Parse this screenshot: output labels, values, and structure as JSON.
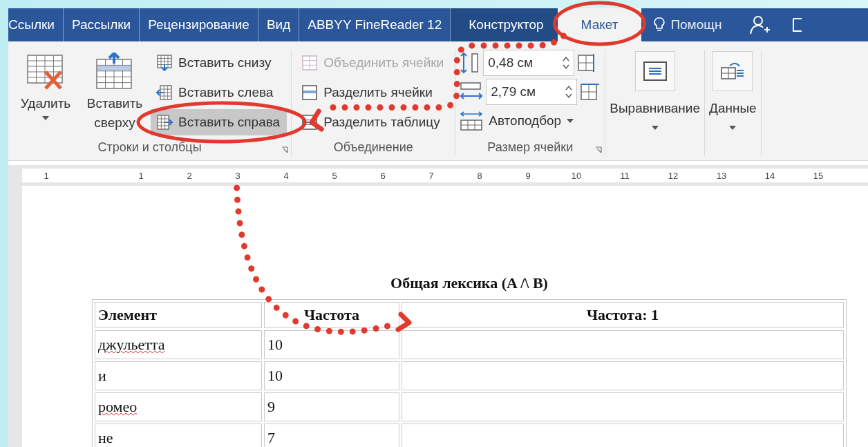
{
  "tabs": [
    {
      "label": "Ссылки",
      "selected": false
    },
    {
      "label": "Рассылки",
      "selected": false
    },
    {
      "label": "Рецензирование",
      "selected": false
    },
    {
      "label": "Вид",
      "selected": false
    },
    {
      "label": "ABBYY FineReader 12",
      "selected": false
    },
    {
      "label": "Конструктор",
      "selected": false
    },
    {
      "label": "Макет",
      "selected": true
    }
  ],
  "help": {
    "label": "Помощн"
  },
  "ribbon": {
    "groups": [
      {
        "label": "Строки и столбцы",
        "large_buttons": [
          {
            "label": "Удалить",
            "dropdown": true
          },
          {
            "label": "Вставить сверху",
            "dropdown": false
          }
        ],
        "small_buttons": [
          {
            "label": "Вставить снизу",
            "highlighted": false,
            "disabled": false
          },
          {
            "label": "Вставить слева",
            "highlighted": false,
            "disabled": false
          },
          {
            "label": "Вставить справа",
            "highlighted": true,
            "disabled": false
          }
        ]
      },
      {
        "label": "Объединение",
        "small_buttons": [
          {
            "label": "Объединить ячейки",
            "highlighted": false,
            "disabled": true
          },
          {
            "label": "Разделить ячейки",
            "highlighted": false,
            "disabled": false
          },
          {
            "label": "Разделить таблицу",
            "highlighted": false,
            "disabled": false
          }
        ]
      },
      {
        "label": "Размер ячейки",
        "fields": [
          {
            "value": "0,48 см"
          },
          {
            "value": "2,79 см"
          }
        ],
        "autofit": {
          "label": "Автоподбор"
        }
      }
    ],
    "menus": [
      {
        "label": "Выравнивание"
      },
      {
        "label": "Данные"
      }
    ]
  },
  "ruler": [
    "1",
    "1",
    "2",
    "3",
    "4",
    "5",
    "6",
    "7",
    "8",
    "9",
    "10",
    "11",
    "12",
    "13",
    "14",
    "15"
  ],
  "document": {
    "title": "Общая лексика (A /\\ B)",
    "table": {
      "columns": [
        "Элемент",
        "Частота",
        "Частота: 1"
      ],
      "rows": [
        {
          "cells": [
            "джульетта",
            "10",
            ""
          ],
          "misspelled": true
        },
        {
          "cells": [
            "и",
            "10",
            ""
          ],
          "misspelled": false
        },
        {
          "cells": [
            "ромео",
            "9",
            ""
          ],
          "misspelled": true
        },
        {
          "cells": [
            "не",
            "7",
            ""
          ],
          "misspelled": false
        }
      ]
    }
  }
}
